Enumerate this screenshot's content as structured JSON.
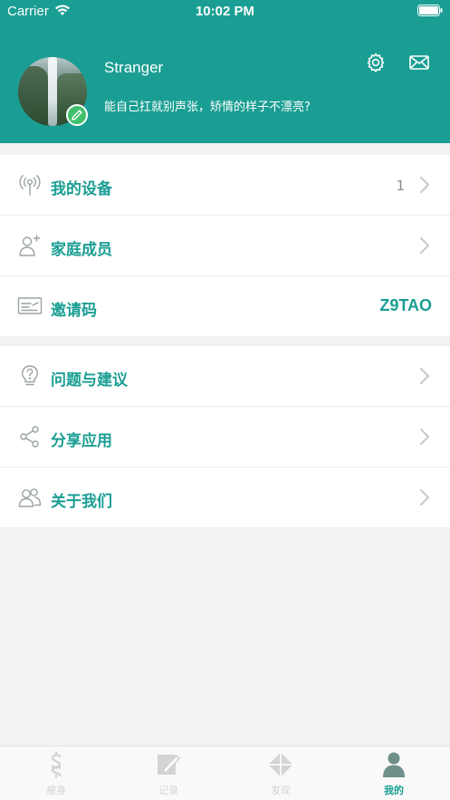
{
  "status_bar": {
    "carrier": "Carrier",
    "time": "10:02 PM",
    "wifi_icon": "wifi-icon",
    "battery_icon": "battery-icon"
  },
  "profile": {
    "name": "Stranger",
    "bio": "能自己扛就别声张，矫情的样子不漂亮?",
    "avatar": "waterfall-photo",
    "edit_icon": "pencil-icon"
  },
  "header_actions": {
    "settings_icon": "gear-icon",
    "messages_icon": "mail-icon"
  },
  "menu_group_1": [
    {
      "icon": "signal-tower-icon",
      "label": "我的设备",
      "value": "1"
    },
    {
      "icon": "add-person-icon",
      "label": "家庭成员"
    },
    {
      "icon": "card-icon",
      "label": "邀请码",
      "code": "Z9TAO"
    }
  ],
  "menu_group_2": [
    {
      "icon": "lightbulb-question-icon",
      "label": "问题与建议"
    },
    {
      "icon": "share-icon",
      "label": "分享应用"
    },
    {
      "icon": "people-icon",
      "label": "关于我们"
    }
  ],
  "tabs": [
    {
      "label": "瘦身",
      "icon": "dollar-body-icon",
      "active": false
    },
    {
      "label": "记录",
      "icon": "note-edit-icon",
      "active": false
    },
    {
      "label": "发现",
      "icon": "compass-diamond-icon",
      "active": false
    },
    {
      "label": "我的",
      "icon": "person-icon",
      "active": true
    }
  ],
  "colors": {
    "brand": "#1a9e93",
    "badge_green": "#3fbf6a",
    "inactive_tab": "#d4d4d4"
  }
}
